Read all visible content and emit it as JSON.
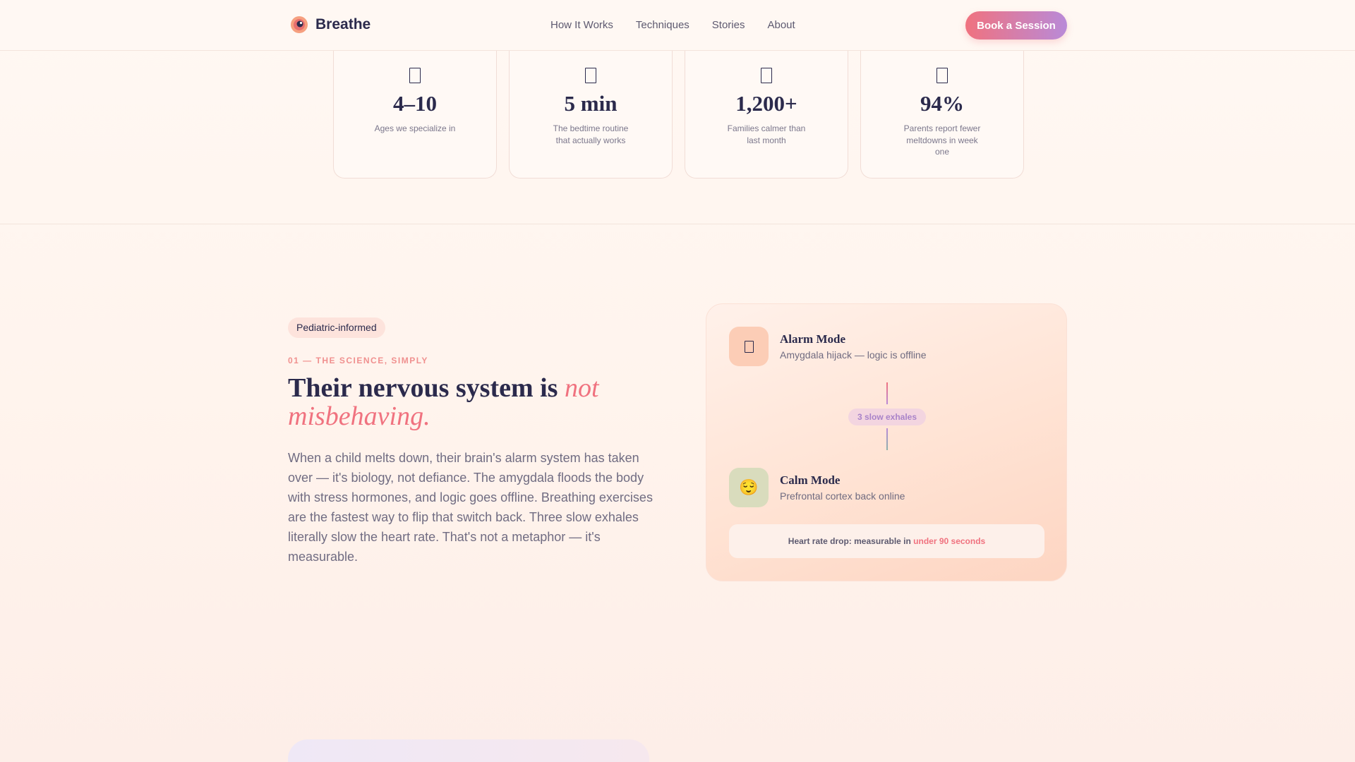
{
  "header": {
    "brand": "Breathe",
    "nav": [
      "How It Works",
      "Techniques",
      "Stories",
      "About"
    ],
    "cta": "Book a Session"
  },
  "stats": [
    {
      "icon": "stat-icon",
      "value": "4–10",
      "label": "Ages we specialize in"
    },
    {
      "icon": "stat-icon",
      "value": "5 min",
      "label": "The bedtime routine that actually works"
    },
    {
      "icon": "stat-icon",
      "value": "1,200+",
      "label": "Families calmer than last month"
    },
    {
      "icon": "stat-icon",
      "value": "94%",
      "label": "Parents report fewer meltdowns in week one"
    }
  ],
  "science": {
    "badge": "Pediatric-informed",
    "eyebrow": "01 — THE SCIENCE, SIMPLY",
    "headline_plain": "Their nervous system is ",
    "headline_accent": "not misbehaving.",
    "body": "When a child melts down, their brain's alarm system has taken over — it's biology, not defiance. The amygdala floods the body with stress hormones, and logic goes offline. Breathing exercises are the fastest way to flip that switch back. Three slow exhales literally slow the heart rate. That's not a metaphor — it's measurable."
  },
  "card": {
    "alarm_icon": "alarm-icon",
    "alarm_title": "Alarm Mode",
    "alarm_sub": "Amygdala hijack — logic is offline",
    "exhale_label": "3 slow exhales",
    "calm_icon": "😌",
    "calm_title": "Calm Mode",
    "calm_sub": "Prefrontal cortex back online",
    "heart_prefix": "Heart rate drop: measurable in ",
    "heart_highlight": "under 90 seconds"
  },
  "colors": {
    "accent": "#f0727f",
    "accent_purple": "#b98ad8",
    "ink": "#2b2a4c"
  }
}
